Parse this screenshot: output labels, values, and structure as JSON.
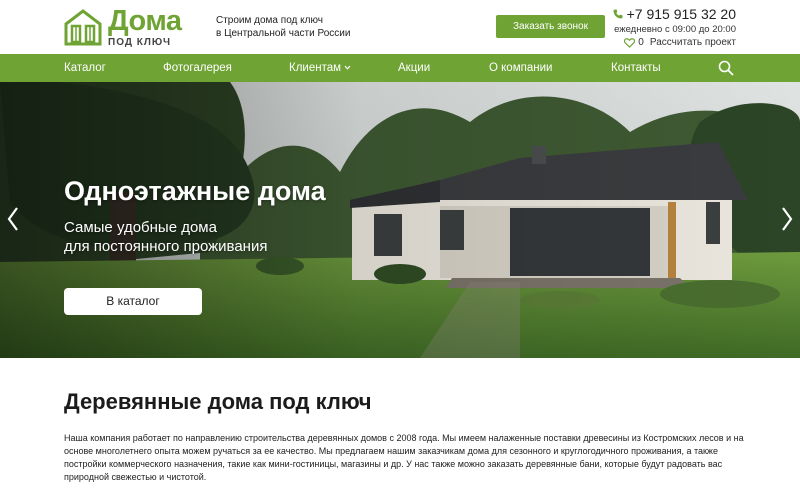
{
  "header": {
    "logo_word": "Дома",
    "logo_sub": "ПОД КЛЮЧ",
    "tagline_line1": "Строим дома под ключ",
    "tagline_line2": "в Центральной части России",
    "call_button": "Заказать звонок",
    "phone": "+7 915 915 32 20",
    "hours": "ежедневно с 09:00 до 20:00",
    "favorites_count": "0",
    "calc_link": "Рассчитать проект",
    "icons": [
      "house-logo-icon",
      "phone-icon",
      "heart-icon"
    ]
  },
  "nav": {
    "items": [
      "Каталог",
      "Фотогалерея",
      "Клиентам",
      "Акции",
      "О компании",
      "Контакты"
    ],
    "search_icon": "search-icon",
    "dropdown_icon": "chevron-down-icon"
  },
  "hero": {
    "title": "Одноэтажные дома",
    "subtitle_line1": "Самые удобные дома",
    "subtitle_line2": "для постоянного проживания",
    "button": "В каталог",
    "arrows": [
      "chevron-left-icon",
      "chevron-right-icon"
    ]
  },
  "content": {
    "title": "Деревянные дома под ключ",
    "text": "Наша компания работает по направлению строительства деревянных домов с 2008 года. Мы имеем налаженные поставки древесины из Костромских лесов и на основе многолетнего опыта можем ручаться за ее качество. Мы предлагаем нашим заказчикам дома для сезонного и круглогодичного проживания, а также постройки коммерческого назначения, такие как мини-гостиницы, магазины и др. У нас также можно заказать деревянные бани, которые будут радовать вас природной свежестью и чистотой."
  },
  "colors": {
    "brand_green": "#6fa334",
    "text_dark": "#222222",
    "white": "#ffffff"
  }
}
